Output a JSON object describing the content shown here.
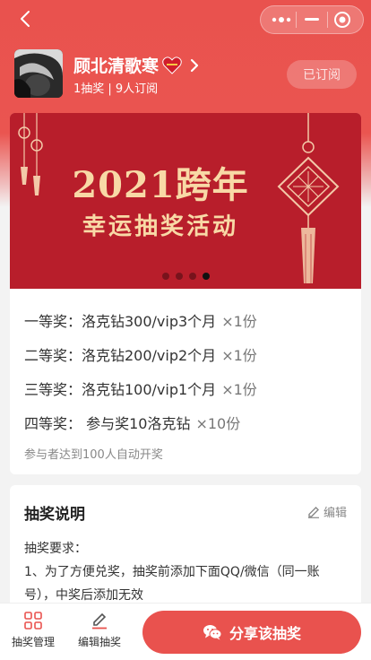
{
  "profile": {
    "name": "顾北清歌寒",
    "stats": "1抽奖 | 9人订阅",
    "subscribe_label": "已订阅"
  },
  "banner": {
    "title": "2021跨年",
    "subtitle": "幸运抽奖活动",
    "dot_count": 4,
    "active_dot": 4
  },
  "prizes": [
    {
      "label": "一等奖：洛克钻300/vip3个月",
      "qty": "×1份"
    },
    {
      "label": "二等奖：洛克钻200/vip2个月",
      "qty": "×1份"
    },
    {
      "label": "三等奖：洛克钻100/vip1个月",
      "qty": "×1份"
    },
    {
      "label": "四等奖：  参与奖10洛克钻",
      "qty": "×10份"
    }
  ],
  "auto_draw_note": "参与者达到100人自动开奖",
  "description": {
    "title": "抽奖说明",
    "edit_label": "编辑",
    "lines": [
      "抽奖要求：",
      "1、为了方便兑奖，抽奖前添加下面QQ/微信（同一账号），中奖后添加无效"
    ]
  },
  "bottom": {
    "manage_label": "抽奖管理",
    "edit_label": "编辑抽奖",
    "share_label": "分享该抽奖"
  },
  "colors": {
    "accent": "#e9524e",
    "banner": "#b81e2b",
    "banner_text": "#f8d9a6"
  }
}
